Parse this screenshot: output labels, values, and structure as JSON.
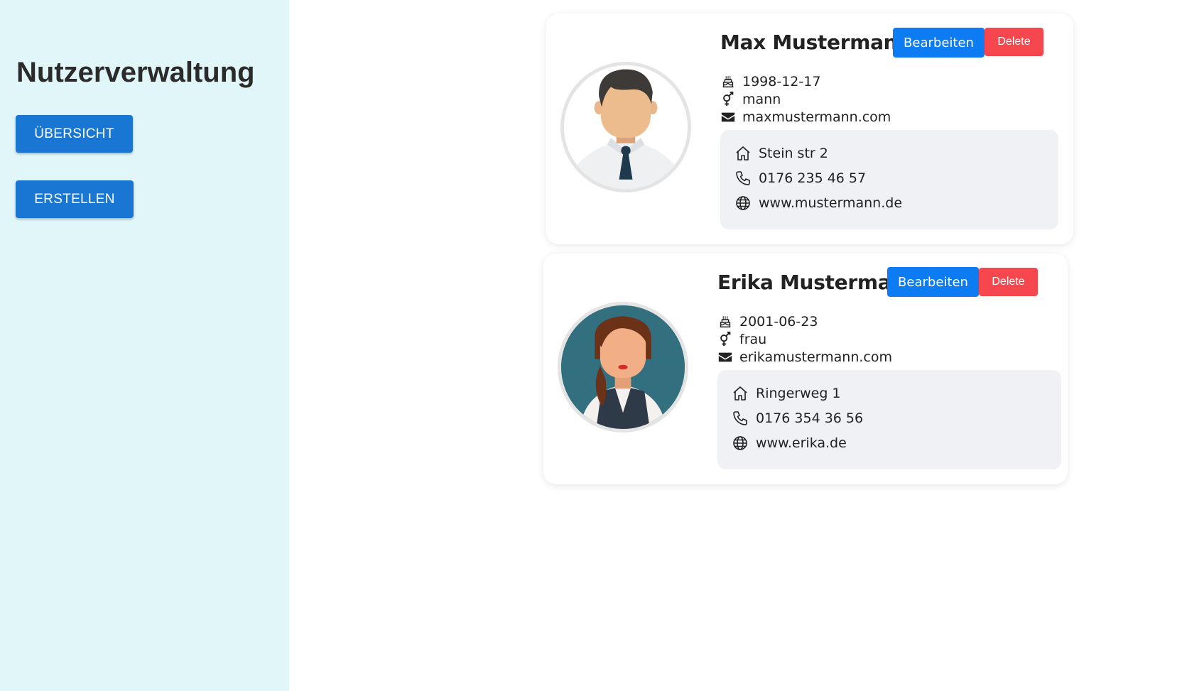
{
  "sidebar": {
    "title": "Nutzerverwaltung",
    "overview_label": "ÜBERSICHT",
    "create_label": "ERSTELLEN"
  },
  "users": [
    {
      "name": "Max Mustermann",
      "edit_label": "Bearbeiten",
      "delete_label": "Delete",
      "birthdate": "1998-12-17",
      "gender": "mann",
      "email": "maxmustermann.com",
      "address": "Stein str 2",
      "phone": "0176 235 46 57",
      "website": "www.mustermann.de",
      "avatar": "male-avatar"
    },
    {
      "name": "Erika Mustermann",
      "edit_label": "Bearbeiten",
      "delete_label": "Delete",
      "birthdate": "2001-06-23",
      "gender": "frau",
      "email": "erikamustermann.com",
      "address": "Ringerweg 1",
      "phone": "0176 354 36 56",
      "website": "www.erika.de",
      "avatar": "female-avatar"
    }
  ],
  "colors": {
    "sidebar_bg": "#e1f6f9",
    "nav_button": "#1976d2",
    "edit_button": "#0d7cf2",
    "delete_button": "#f7474e",
    "contact_box_bg": "#f0f1f5",
    "female_avatar_bg": "#33707f"
  }
}
